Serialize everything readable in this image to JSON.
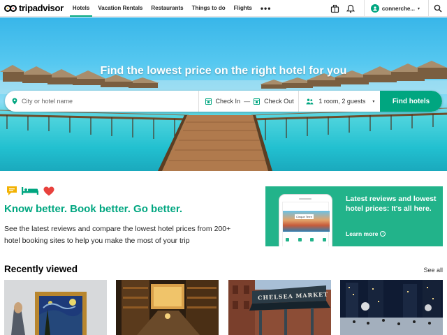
{
  "brand": {
    "name": "tripadvisor",
    "accent": "#00a680"
  },
  "nav": {
    "tabs": [
      {
        "label": "Hotels",
        "active": true
      },
      {
        "label": "Vacation Rentals"
      },
      {
        "label": "Restaurants"
      },
      {
        "label": "Things to do"
      },
      {
        "label": "Flights"
      },
      {
        "label": "•••",
        "icon": "more-icon"
      }
    ],
    "icons": [
      "trips-suitcase-icon",
      "bell-icon",
      "user-avatar-icon",
      "search-icon"
    ],
    "username": "connerche...",
    "caret": "▾"
  },
  "hero": {
    "title": "Find the lowest price on the right hotel for you",
    "search": {
      "city_placeholder": "City or hotel name",
      "check_in": "Check In",
      "dash": "—",
      "check_out": "Check Out",
      "guests": "1 room, 2 guests",
      "button": "Find hotels"
    }
  },
  "promo": {
    "icons": [
      "review-bubble-icon",
      "bed-icon",
      "heart-icon"
    ],
    "heading": "Know better. Book better. Go better.",
    "body": "See the latest reviews and compare the lowest hotel prices from 200+ hotel booking sites to help you make the most of your trip",
    "card": {
      "text": "Latest reviews and lowest hotel prices: It's all here.",
      "phone_label": "Cinque Terre",
      "learn_more": "Learn more",
      "arrow": "›"
    }
  },
  "recently_viewed": {
    "title": "Recently viewed",
    "see_all": "See all",
    "items": [
      {
        "name": "museum-painting-thumbnail",
        "sign": ""
      },
      {
        "name": "library-interior-thumbnail",
        "sign": ""
      },
      {
        "name": "chelsea-market-thumbnail",
        "sign": "CHELSEA MARKET"
      },
      {
        "name": "ice-rink-night-thumbnail",
        "sign": ""
      }
    ]
  }
}
